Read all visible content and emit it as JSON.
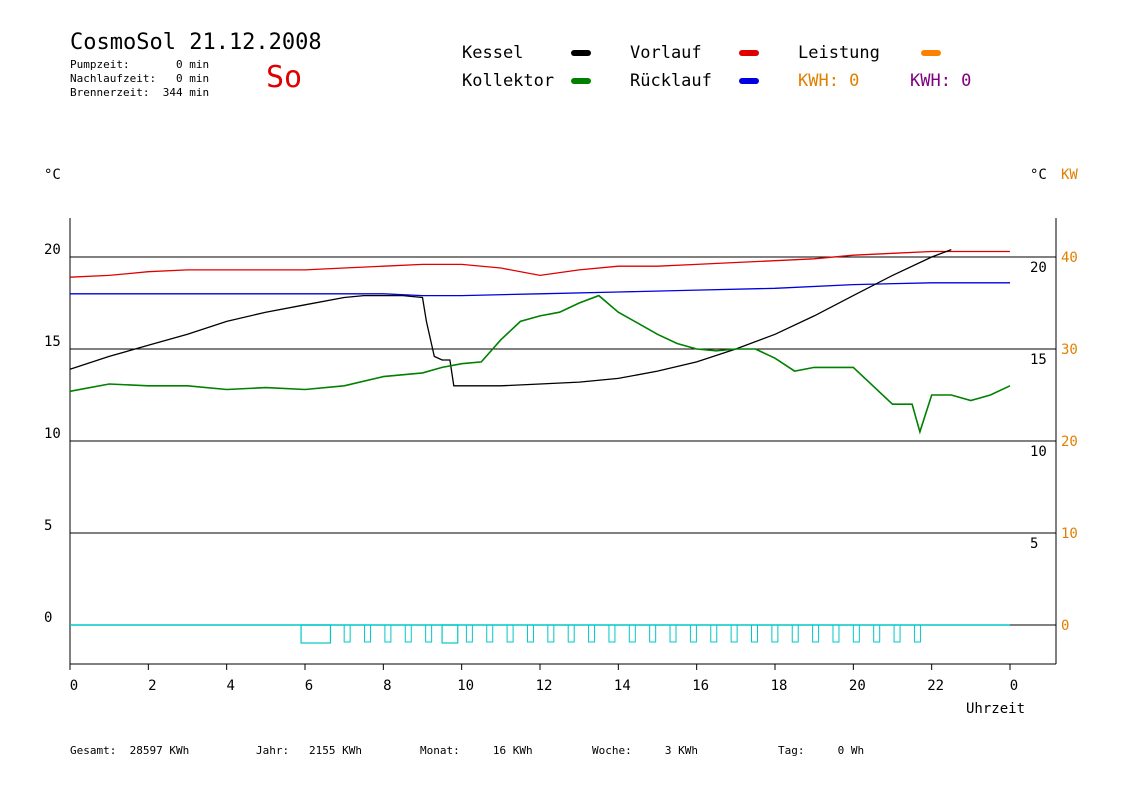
{
  "header": {
    "title": "CosmoSol 21.12.2008",
    "pumpzeit": "Pumpzeit:       0 min",
    "nachlaufzeit": "Nachlaufzeit:   0 min",
    "brennerzeit": "Brennerzeit:  344 min",
    "day": "So"
  },
  "legend": {
    "kessel": "Kessel",
    "kollektor": "Kollektor",
    "vorlauf": "Vorlauf",
    "ruecklauf": "Rücklauf",
    "leistung": "Leistung",
    "kwh1": "KWH: 0",
    "kwh2": "KWH: 0",
    "colors": {
      "kessel": "#000000",
      "kollektor": "#008000",
      "vorlauf": "#e00000",
      "ruecklauf": "#0000e0",
      "leistung": "#ff8000",
      "kwh2": "#800080",
      "pump": "#00c8c8"
    }
  },
  "axes": {
    "left_unit": "°C",
    "right_unit": "°C",
    "right_unit2": "KW",
    "xlabel": "Uhrzeit"
  },
  "footer": {
    "gesamt": "Gesamt:  28597 KWh",
    "jahr": "Jahr:   2155 KWh",
    "monat": "Monat:     16 KWh",
    "woche": "Woche:     3 KWh",
    "tag": "Tag:     0 Wh"
  },
  "chart_data": {
    "type": "line",
    "xlim": [
      0,
      24
    ],
    "ylim": [
      -2.5,
      22.5
    ],
    "x_ticks": [
      "0",
      "2",
      "4",
      "6",
      "8",
      "10",
      "12",
      "14",
      "16",
      "18",
      "20",
      "22",
      "0"
    ],
    "y_ticks_left": [
      "0",
      "5",
      "10",
      "15",
      "20"
    ],
    "y_ticks_right": [
      "5",
      "10",
      "15",
      "20"
    ],
    "y_ticks_right_kw": [
      "0",
      "10",
      "20",
      "30",
      "40"
    ],
    "grid_y": [
      0,
      5,
      10,
      15,
      20
    ],
    "series": [
      {
        "name": "Vorlauf",
        "color": "#e00000",
        "x": [
          0,
          1,
          2,
          3,
          4,
          5,
          6,
          7,
          8,
          9,
          10,
          11,
          12,
          13,
          14,
          15,
          16,
          17,
          18,
          19,
          20,
          21,
          22,
          23,
          24
        ],
        "y": [
          18.9,
          19.0,
          19.2,
          19.3,
          19.3,
          19.3,
          19.3,
          19.4,
          19.5,
          19.6,
          19.6,
          19.4,
          19.0,
          19.3,
          19.5,
          19.5,
          19.6,
          19.7,
          19.8,
          19.9,
          20.1,
          20.2,
          20.3,
          20.3,
          20.3
        ]
      },
      {
        "name": "Rücklauf",
        "color": "#0000e0",
        "x": [
          0,
          2,
          4,
          6,
          8,
          9,
          10,
          12,
          14,
          16,
          18,
          20,
          22,
          24
        ],
        "y": [
          18.0,
          18.0,
          18.0,
          18.0,
          18.0,
          17.9,
          17.9,
          18.0,
          18.1,
          18.2,
          18.3,
          18.5,
          18.6,
          18.6
        ]
      },
      {
        "name": "Kessel",
        "color": "#000000",
        "x": [
          0,
          1,
          2,
          3,
          4,
          5,
          6,
          7,
          7.5,
          8,
          8.5,
          9,
          9.1,
          9.3,
          9.5,
          9.7,
          9.8,
          10,
          11,
          12,
          13,
          14,
          15,
          16,
          17,
          18,
          19,
          20,
          21,
          22,
          22.5
        ],
        "y": [
          13.9,
          14.6,
          15.2,
          15.8,
          16.5,
          17.0,
          17.4,
          17.8,
          17.9,
          17.9,
          17.9,
          17.8,
          16.5,
          14.6,
          14.4,
          14.4,
          13.0,
          13.0,
          13.0,
          13.1,
          13.2,
          13.4,
          13.8,
          14.3,
          15.0,
          15.8,
          16.8,
          17.9,
          19.0,
          20.0,
          20.4
        ]
      },
      {
        "name": "Kollektor",
        "color": "#008000",
        "x": [
          0,
          1,
          2,
          3,
          4,
          5,
          6,
          7,
          8,
          9,
          9.5,
          10,
          10.5,
          11,
          11.5,
          12,
          12.5,
          13,
          13.5,
          14,
          14.5,
          15,
          15.5,
          16,
          16.5,
          17,
          17.5,
          18,
          18.5,
          19,
          20,
          20.5,
          21,
          21.5,
          21.7,
          22,
          22.5,
          23,
          23.5,
          24
        ],
        "y": [
          12.7,
          13.1,
          13.0,
          13.0,
          12.8,
          12.9,
          12.8,
          13.0,
          13.5,
          13.7,
          14.0,
          14.2,
          14.3,
          15.5,
          16.5,
          16.8,
          17.0,
          17.5,
          17.9,
          17.0,
          16.4,
          15.8,
          15.3,
          15.0,
          14.9,
          15.0,
          15.0,
          14.5,
          13.8,
          14.0,
          14.0,
          13.0,
          12.0,
          12.0,
          10.5,
          12.5,
          12.5,
          12.2,
          12.5,
          13.0
        ]
      }
    ]
  }
}
